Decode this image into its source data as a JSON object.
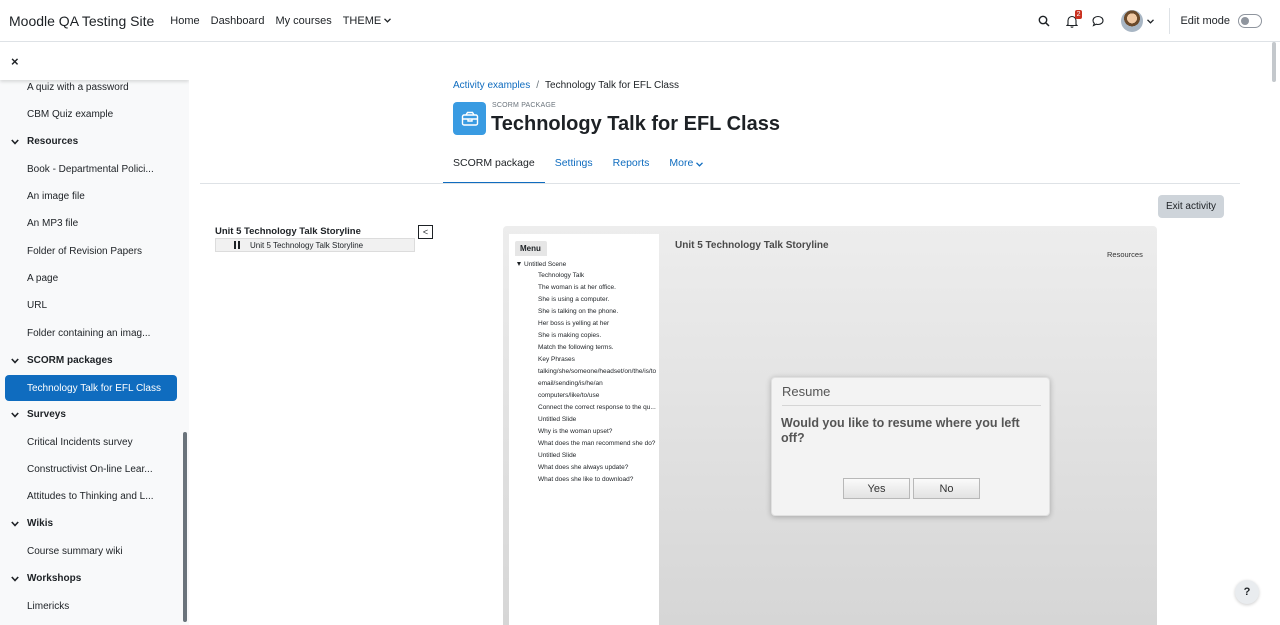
{
  "navbar": {
    "brand": "Moodle QA Testing Site",
    "links": [
      "Home",
      "Dashboard",
      "My courses"
    ],
    "theme_label": "THEME",
    "notification_count": "2",
    "edit_mode_label": "Edit mode",
    "edit_mode_on": false,
    "icons": [
      "search-icon",
      "bell-icon",
      "chat-icon",
      "avatar",
      "chevron-down-icon"
    ]
  },
  "drawer": {
    "close_glyph": "×",
    "items": [
      "A quiz with a password",
      "CBM Quiz example",
      "Resources",
      "Book - Departmental Polici...",
      "An image file",
      "An MP3 file",
      "Folder of Revision Papers",
      "A page",
      "URL",
      "Folder containing an imag...",
      "SCORM packages",
      "Technology Talk for EFL Class",
      "Surveys",
      "Critical Incidents survey",
      "Constructivist On-line Lear...",
      "Attitudes to Thinking and L...",
      "Wikis",
      "Course summary wiki",
      "Workshops",
      "Limericks"
    ],
    "active_item": "Technology Talk for EFL Class"
  },
  "breadcrumb": {
    "parent": "Activity examples",
    "separator": "/",
    "current": "Technology Talk for EFL Class"
  },
  "header": {
    "module_kind": "SCORM PACKAGE",
    "title": "Technology Talk for EFL Class",
    "icon_color": "#399be2"
  },
  "tabs": [
    "SCORM package",
    "Settings",
    "Reports",
    "More"
  ],
  "active_tab": "SCORM package",
  "exit_button": "Exit activity",
  "toc": {
    "title": "Unit 5 Technology Talk Storyline",
    "toggle": "<",
    "item": "Unit 5 Technology Talk Storyline"
  },
  "player": {
    "menu_label": "Menu",
    "scene": "Untitled Scene",
    "menu_items": [
      "Technology Talk",
      "The woman is at her office.",
      "She is using a computer.",
      "She is talking on the phone.",
      "Her boss is yelling at her",
      "She is making copies.",
      "Match the following terms.",
      "Key Phrases",
      "talking/she/someone/headset/on/the/is/to",
      "email/sending/is/he/an",
      "computers/like/to/use",
      "Connect the correct response to the qu...",
      "Untitled Slide",
      "Why is the woman upset?",
      "What does the man recommend she do?",
      "Untitled Slide",
      "What does she always update?",
      "What does she like to download?"
    ],
    "slide_title": "Unit 5 Technology Talk Storyline",
    "resources_label": "Resources",
    "dialog": {
      "title": "Resume",
      "question": "Would you like to resume where you left off?",
      "yes": "Yes",
      "no": "No"
    }
  },
  "help_label": "?",
  "colors": {
    "primary": "#0f6cbf",
    "drawer_bg": "#f8f9fa",
    "text": "#1d2125",
    "badge": "#ca3120"
  }
}
